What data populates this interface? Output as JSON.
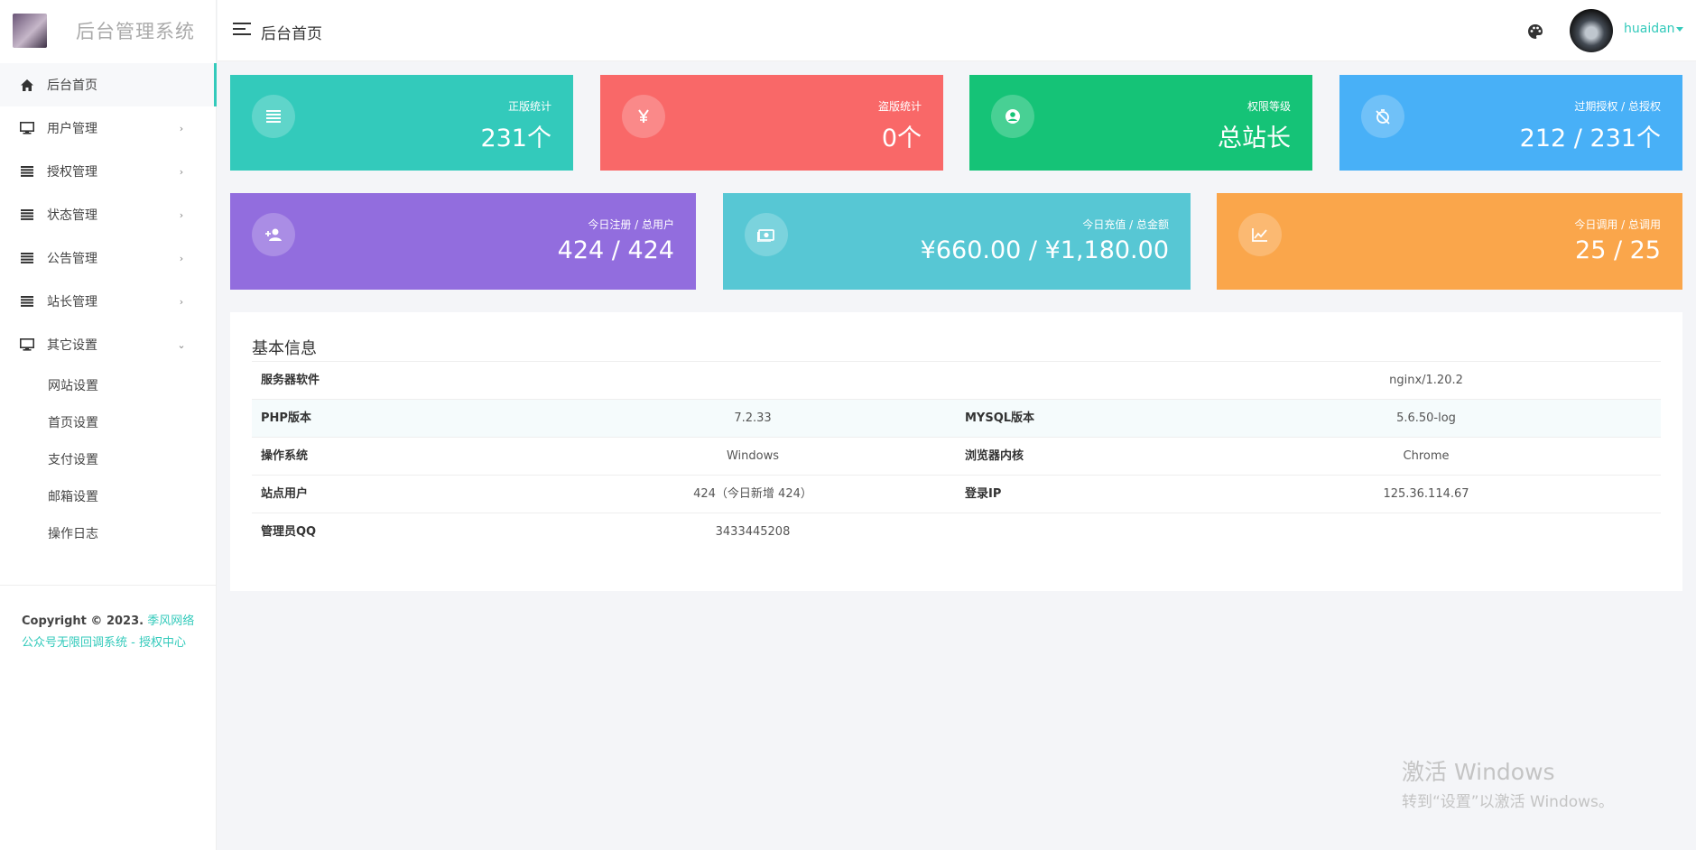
{
  "sidebar": {
    "brand_title": "后台管理系统",
    "menu": [
      {
        "label": "后台首页"
      },
      {
        "label": "用户管理",
        "arrow": "›"
      },
      {
        "label": "授权管理",
        "arrow": "›"
      },
      {
        "label": "状态管理",
        "arrow": "›"
      },
      {
        "label": "公告管理",
        "arrow": "›"
      },
      {
        "label": "站长管理",
        "arrow": "›"
      },
      {
        "label": "其它设置",
        "arrow": "⌄"
      }
    ],
    "submenu": [
      {
        "label": "网站设置"
      },
      {
        "label": "首页设置"
      },
      {
        "label": "支付设置"
      },
      {
        "label": "邮箱设置"
      },
      {
        "label": "操作日志"
      }
    ],
    "footer": {
      "copyright": "Copyright © 2023.",
      "link": "季风网络公众号无限回调系统 - 授权中心"
    }
  },
  "header": {
    "title": "后台首页",
    "user_name": "huaidan"
  },
  "cards": [
    {
      "label": "正版统计",
      "value": "231个",
      "color": "#33cabb",
      "icon": "list-icon"
    },
    {
      "label": "盗版统计",
      "value": "0个",
      "color": "#f96868",
      "icon": "yen-icon"
    },
    {
      "label": "权限等级",
      "value": "总站长",
      "color": "#15c377",
      "icon": "user-circle-icon"
    },
    {
      "label": "过期授权 / 总授权",
      "value": "212 / 231个",
      "color": "#48b0f7",
      "icon": "timer-off-icon"
    },
    {
      "label": "今日注册 / 总用户",
      "value": "424 / 424",
      "color": "#926dde",
      "icon": "user-add-icon"
    },
    {
      "label": "今日充值 / 总金额",
      "value": "¥660.00 / ¥1,180.00",
      "color": "#57c7d4",
      "icon": "cash-icon"
    },
    {
      "label": "今日调用 / 总调用",
      "value": "25 / 25",
      "color": "#faa64b",
      "icon": "line-chart-icon"
    }
  ],
  "info": {
    "title": "基本信息",
    "server_label": "服务器软件",
    "server_value": "nginx/1.20.2",
    "php_label": "PHP版本",
    "php_value": "7.2.33",
    "mysql_label": "MYSQL版本",
    "mysql_value": "5.6.50-log",
    "os_label": "操作系统",
    "os_value": "Windows",
    "browser_label": "浏览器内核",
    "browser_value": "Chrome",
    "users_label": "站点用户",
    "users_value": "424（今日新增 424）",
    "ip_label": "登录IP",
    "ip_value": "125.36.114.67",
    "qq_label": "管理员QQ",
    "qq_value": "3433445208"
  },
  "watermark": {
    "line1": "激活 Windows",
    "line2": "转到“设置”以激活 Windows。"
  }
}
